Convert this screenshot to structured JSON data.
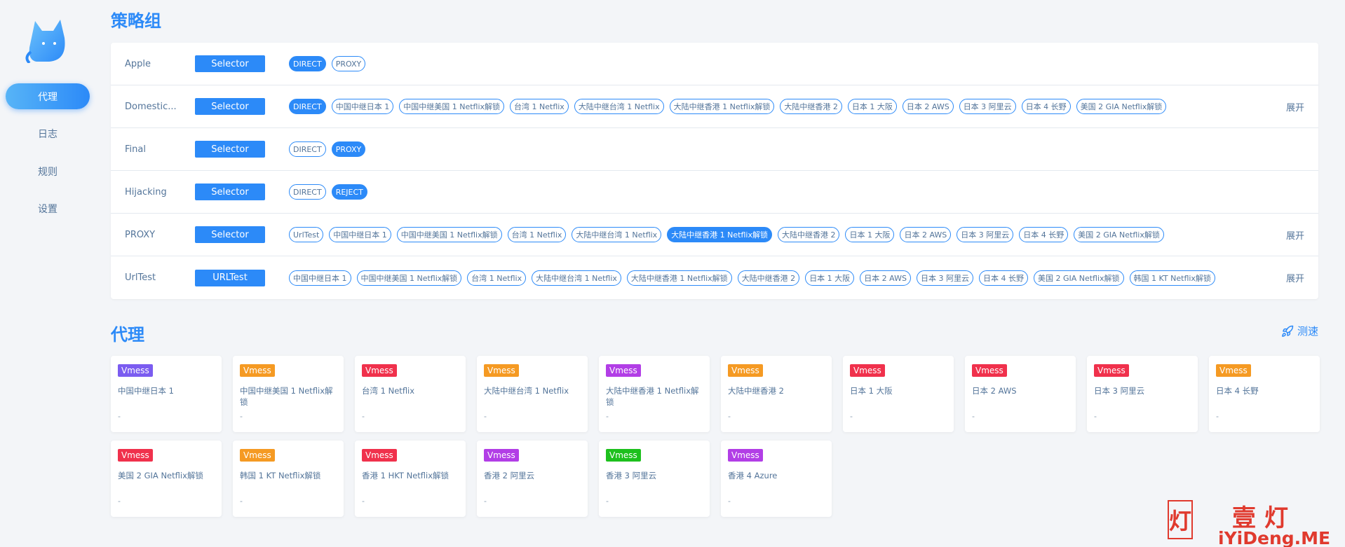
{
  "sidebar": {
    "items": [
      {
        "label": "代理",
        "active": true
      },
      {
        "label": "日志",
        "active": false
      },
      {
        "label": "规则",
        "active": false
      },
      {
        "label": "设置",
        "active": false
      }
    ]
  },
  "groups_title": "策略组",
  "groups": [
    {
      "name": "Apple",
      "type": "Selector",
      "options": [
        "DIRECT",
        "PROXY"
      ],
      "selected": 0,
      "expand": ""
    },
    {
      "name": "Domestic...",
      "type": "Selector",
      "options": [
        "DIRECT",
        "中国中继日本 1",
        "中国中继美国 1 Netflix解锁",
        "台湾 1 Netflix",
        "大陆中继台湾 1 Netflix",
        "大陆中继香港 1 Netflix解锁",
        "大陆中继香港 2",
        "日本 1 大阪",
        "日本 2 AWS",
        "日本 3 阿里云",
        "日本 4 长野",
        "美国 2 GIA Netflix解锁"
      ],
      "selected": 0,
      "expand": "展开"
    },
    {
      "name": "Final",
      "type": "Selector",
      "options": [
        "DIRECT",
        "PROXY"
      ],
      "selected": 1,
      "expand": ""
    },
    {
      "name": "Hijacking",
      "type": "Selector",
      "options": [
        "DIRECT",
        "REJECT"
      ],
      "selected": 1,
      "expand": ""
    },
    {
      "name": "PROXY",
      "type": "Selector",
      "options": [
        "UrlTest",
        "中国中继日本 1",
        "中国中继美国 1 Netflix解锁",
        "台湾 1 Netflix",
        "大陆中继台湾 1 Netflix",
        "大陆中继香港 1 Netflix解锁",
        "大陆中继香港 2",
        "日本 1 大阪",
        "日本 2 AWS",
        "日本 3 阿里云",
        "日本 4 长野",
        "美国 2 GIA Netflix解锁"
      ],
      "selected": 5,
      "expand": "展开"
    },
    {
      "name": "UrlTest",
      "type": "URLTest",
      "options": [
        "中国中继日本 1",
        "中国中继美国 1 Netflix解锁",
        "台湾 1 Netflix",
        "大陆中继台湾 1 Netflix",
        "大陆中继香港 1 Netflix解锁",
        "大陆中继香港 2",
        "日本 1 大阪",
        "日本 2 AWS",
        "日本 3 阿里云",
        "日本 4 长野",
        "美国 2 GIA Netflix解锁",
        "韩国 1 KT Netflix解锁"
      ],
      "selected": -1,
      "expand": "展开"
    }
  ],
  "proxies_title": "代理",
  "speedtest_label": "测速",
  "colors": {
    "accent": "#2c8af8",
    "text": "#54759a"
  },
  "proxies": [
    {
      "type": "Vmess",
      "name": "中国中继日本 1",
      "delay": "-",
      "color": "#7b5cf0"
    },
    {
      "type": "Vmess",
      "name": "中国中继美国 1 Netflix解锁",
      "delay": "-",
      "color": "#f59a23"
    },
    {
      "type": "Vmess",
      "name": "台湾 1 Netflix",
      "delay": "-",
      "color": "#f0314c"
    },
    {
      "type": "Vmess",
      "name": "大陆中继台湾 1 Netflix",
      "delay": "-",
      "color": "#f59a23"
    },
    {
      "type": "Vmess",
      "name": "大陆中继香港 1 Netflix解锁",
      "delay": "-",
      "color": "#b23ee6"
    },
    {
      "type": "Vmess",
      "name": "大陆中继香港 2",
      "delay": "-",
      "color": "#f59a23"
    },
    {
      "type": "Vmess",
      "name": "日本 1 大阪",
      "delay": "-",
      "color": "#f0314c"
    },
    {
      "type": "Vmess",
      "name": "日本 2 AWS",
      "delay": "-",
      "color": "#f0314c"
    },
    {
      "type": "Vmess",
      "name": "日本 3 阿里云",
      "delay": "-",
      "color": "#f0314c"
    },
    {
      "type": "Vmess",
      "name": "日本 4 长野",
      "delay": "-",
      "color": "#f59a23"
    },
    {
      "type": "Vmess",
      "name": "美国 2 GIA Netflix解锁",
      "delay": "-",
      "color": "#f0314c"
    },
    {
      "type": "Vmess",
      "name": "韩国 1 KT Netflix解锁",
      "delay": "-",
      "color": "#f59a23"
    },
    {
      "type": "Vmess",
      "name": "香港 1 HKT Netflix解锁",
      "delay": "-",
      "color": "#f0314c"
    },
    {
      "type": "Vmess",
      "name": "香港 2 阿里云",
      "delay": "-",
      "color": "#b23ee6"
    },
    {
      "type": "Vmess",
      "name": "香港 3 阿里云",
      "delay": "-",
      "color": "#1dc01d"
    },
    {
      "type": "Vmess",
      "name": "香港 4 Azure",
      "delay": "-",
      "color": "#b23ee6"
    }
  ],
  "watermark": {
    "title": "壹灯",
    "stamp": "灯",
    "url": "iYiDeng.ME"
  }
}
